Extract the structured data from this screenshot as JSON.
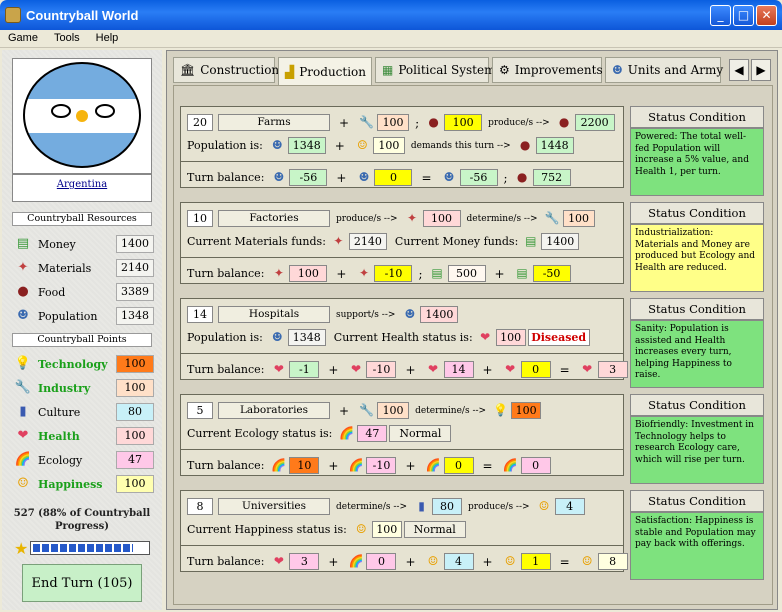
{
  "window": {
    "title": "Countryball World"
  },
  "menu": [
    "Game",
    "Tools",
    "Help"
  ],
  "country": {
    "name": "Argentina"
  },
  "resources": {
    "header": "Countryball Resources",
    "items": [
      {
        "label": "Money",
        "value": "1400",
        "icon": "money-icon"
      },
      {
        "label": "Materials",
        "value": "2140",
        "icon": "materials-icon"
      },
      {
        "label": "Food",
        "value": "3389",
        "icon": "food-icon"
      },
      {
        "label": "Population",
        "value": "1348",
        "icon": "population-icon"
      }
    ]
  },
  "points": {
    "header": "Countryball Points",
    "items": [
      {
        "label": "Technology",
        "value": "100",
        "color": "#ff7a1a"
      },
      {
        "label": "Industry",
        "value": "100",
        "color": "#ffe0c8"
      },
      {
        "label": "Culture",
        "value": "80",
        "color": "#c8f0f8"
      },
      {
        "label": "Health",
        "value": "100",
        "color": "#ffd8d8"
      },
      {
        "label": "Ecology",
        "value": "47",
        "color": "#ffc8e8"
      },
      {
        "label": "Happiness",
        "value": "100",
        "color": "#ffffb0"
      }
    ]
  },
  "progress": {
    "text": "527 (88% of Countryball Progress)",
    "fraction": 0.88
  },
  "end_turn": "End Turn (105)",
  "tabs": [
    {
      "label": "Construction",
      "active": false
    },
    {
      "label": "Production",
      "active": true
    },
    {
      "label": "Political System",
      "active": false
    },
    {
      "label": "Improvements",
      "active": false
    },
    {
      "label": "Units and Army",
      "active": false
    }
  ],
  "words": {
    "population_is": "Population is:",
    "turn_balance": "Turn balance:",
    "produce_s": "produce/s -->",
    "demands": "demands this turn -->",
    "determine": "determine/s -->",
    "support": "support/s -->",
    "cur_materials": "Current Materials funds:",
    "cur_money": "Current Money funds:",
    "cur_health": "Current Health status is:",
    "cur_ecology": "Current Ecology status is:",
    "cur_happiness": "Current Happiness status is:"
  },
  "farms": {
    "count": "20",
    "name": "Farms",
    "tech": "100",
    "food_in": "100",
    "food_out": "2200",
    "population": "1348",
    "happiness": "100",
    "food_demand": "1448",
    "bal1": "-56",
    "bal2": "0",
    "bal3": "-56",
    "bal4": "752"
  },
  "factories": {
    "count": "10",
    "name": "Factories",
    "materials": "100",
    "industry": "100",
    "materials_funds": "2140",
    "money_funds": "1400",
    "bal1": "100",
    "bal2": "-10",
    "bal3": "500",
    "bal4": "-50"
  },
  "hospitals": {
    "count": "14",
    "name": "Hospitals",
    "population_support": "1400",
    "population": "1348",
    "health": "100",
    "health_status": "Diseased",
    "bal1": "-1",
    "bal2": "-10",
    "bal3": "14",
    "bal4": "0",
    "bal5": "3"
  },
  "laboratories": {
    "count": "5",
    "name": "Laboratories",
    "tech": "100",
    "tech_out": "100",
    "ecology": "47",
    "ecology_status": "Normal",
    "bal1": "10",
    "bal2": "-10",
    "bal3": "0",
    "bal4": "0"
  },
  "universities": {
    "count": "8",
    "name": "Universities",
    "culture": "80",
    "happiness_out": "4",
    "happiness": "100",
    "happiness_status": "Normal",
    "bal1": "3",
    "bal2": "0",
    "bal3": "4",
    "bal4": "1",
    "bal5": "8"
  },
  "status": [
    {
      "title": "Status Condition",
      "text": "Powered: The total well-fed Population will increase a 5% value, and Health 1, per turn.",
      "color": "green"
    },
    {
      "title": "Status Condition",
      "text": "Industrialization: Materials and Money are produced but Ecology and Health are reduced.",
      "color": "yellow"
    },
    {
      "title": "Status Condition",
      "text": "Sanity: Population is assisted and Health increases every turn, helping Happiness to raise.",
      "color": "green"
    },
    {
      "title": "Status Condition",
      "text": "Biofriendly: Investment in Technology helps to research Ecology care, which will rise per turn.",
      "color": "green"
    },
    {
      "title": "Status Condition",
      "text": "Satisfaction: Happiness is stable and Population may pay back with offerings.",
      "color": "green"
    }
  ]
}
